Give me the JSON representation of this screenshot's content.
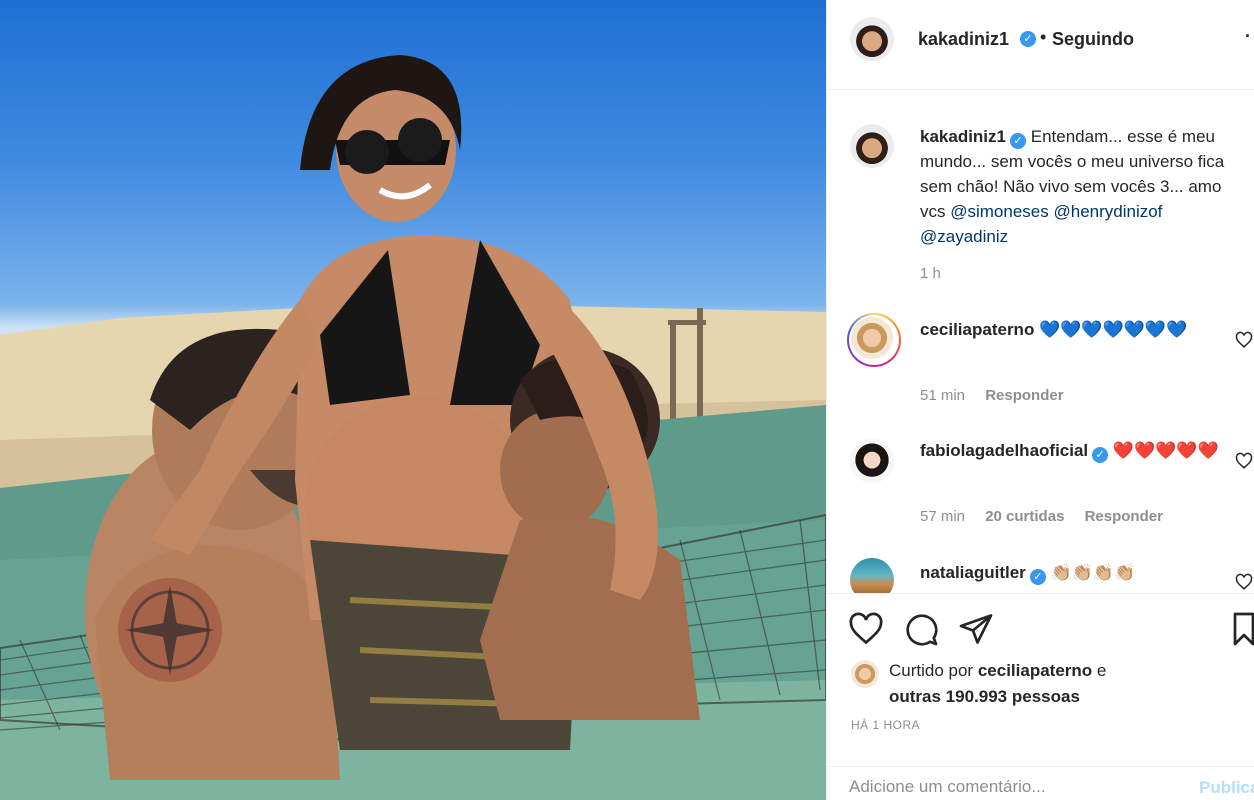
{
  "post": {
    "author": "kakadiniz1",
    "follow_status": "Seguindo",
    "more_icon": "more-options-icon"
  },
  "caption": {
    "username": "kakadiniz1",
    "text": "Entendam... esse é meu mundo... sem vocês o meu universo fica sem chão! Não vivo sem vocês 3... amo vcs",
    "mentions": [
      "@simoneses",
      "@henrydinizof",
      "@zayadiniz"
    ],
    "time": "1 h"
  },
  "comments": [
    {
      "username": "ceciliapaterno",
      "verified": false,
      "text": "💙💙💙💙💙💙💙",
      "time": "51 min",
      "likes": "",
      "reply": "Responder"
    },
    {
      "username": "fabiolagadelhaoficial",
      "verified": true,
      "text": "❤️❤️❤️❤️❤️",
      "time": "57 min",
      "likes": "20 curtidas",
      "reply": "Responder"
    },
    {
      "username": "nataliaguitler",
      "verified": true,
      "text": "👏🏼👏🏼👏🏼👏🏼",
      "time": "",
      "likes": "",
      "reply": ""
    }
  ],
  "likes": {
    "prefix": "Curtido por",
    "user": "ceciliapaterno",
    "connector": "e",
    "others": "outras 190.993 pessoas"
  },
  "time_ago": "HÁ 1 HORA",
  "add_comment": {
    "placeholder": "Adicione um comentário...",
    "post_label": "Publicar"
  },
  "icons": {
    "like": "heart-icon",
    "comment": "comment-icon",
    "share": "share-icon",
    "save": "bookmark-icon"
  },
  "colors": {
    "link": "#00376b",
    "verified": "#3897f0",
    "muted": "#8e8e8e",
    "post_disabled": "#b2dffc"
  }
}
